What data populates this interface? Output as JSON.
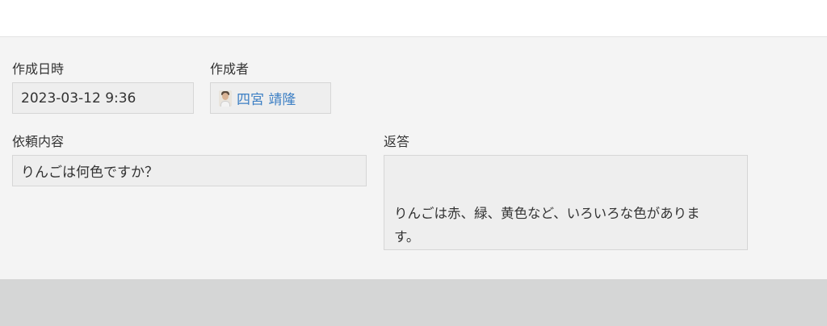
{
  "record": {
    "created_at": {
      "label": "作成日時",
      "value": "2023-03-12 9:36"
    },
    "creator": {
      "label": "作成者",
      "value": "四宮 靖隆",
      "icon": "user-avatar-icon"
    },
    "request": {
      "label": "依頼内容",
      "value": "りんごは何色ですか？"
    },
    "response": {
      "label": "返答",
      "value": "りんごは赤、緑、黄色など、いろいろな色があります。"
    }
  },
  "colors": {
    "panel_background": "#f4f4f4",
    "field_background": "#eeeeee",
    "link": "#3c7fc4",
    "footer_background": "#d5d6d6"
  }
}
